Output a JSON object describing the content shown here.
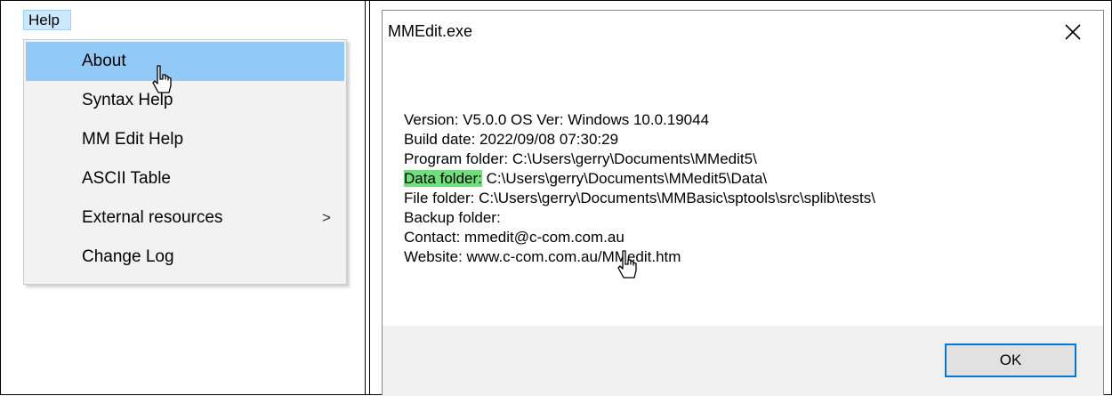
{
  "help_menu": {
    "menubar_label": "Help",
    "items": [
      {
        "label": "About"
      },
      {
        "label": "Syntax Help"
      },
      {
        "label": "MM Edit Help"
      },
      {
        "label": "ASCII Table"
      },
      {
        "label": "External resources",
        "submenu_arrow": ">"
      },
      {
        "label": "Change Log"
      }
    ],
    "highlighted_item": "About",
    "highlight_color": "#91c9f7"
  },
  "about_dialog": {
    "title": "MMEdit.exe",
    "lines": {
      "version": "Version: V5.0.0  OS Ver: Windows 10.0.19044",
      "build_date": "Build date: 2022/09/08 07:30:29",
      "program_folder": "Program folder: C:\\Users\\gerry\\Documents\\MMedit5\\",
      "data_folder_label": "Data folder:",
      "data_folder_value": " C:\\Users\\gerry\\Documents\\MMedit5\\Data\\",
      "file_folder": "File folder: C:\\Users\\gerry\\Documents\\MMBasic\\sptools\\src\\splib\\tests\\",
      "backup_folder": "Backup folder:",
      "contact": "Contact: mmedit@c-com.com.au",
      "website": "Website: www.c-com.com.au/MMedit.htm"
    },
    "highlight_color": "#6ee07a",
    "ok_label": "OK",
    "accent_color": "#0078d7"
  }
}
